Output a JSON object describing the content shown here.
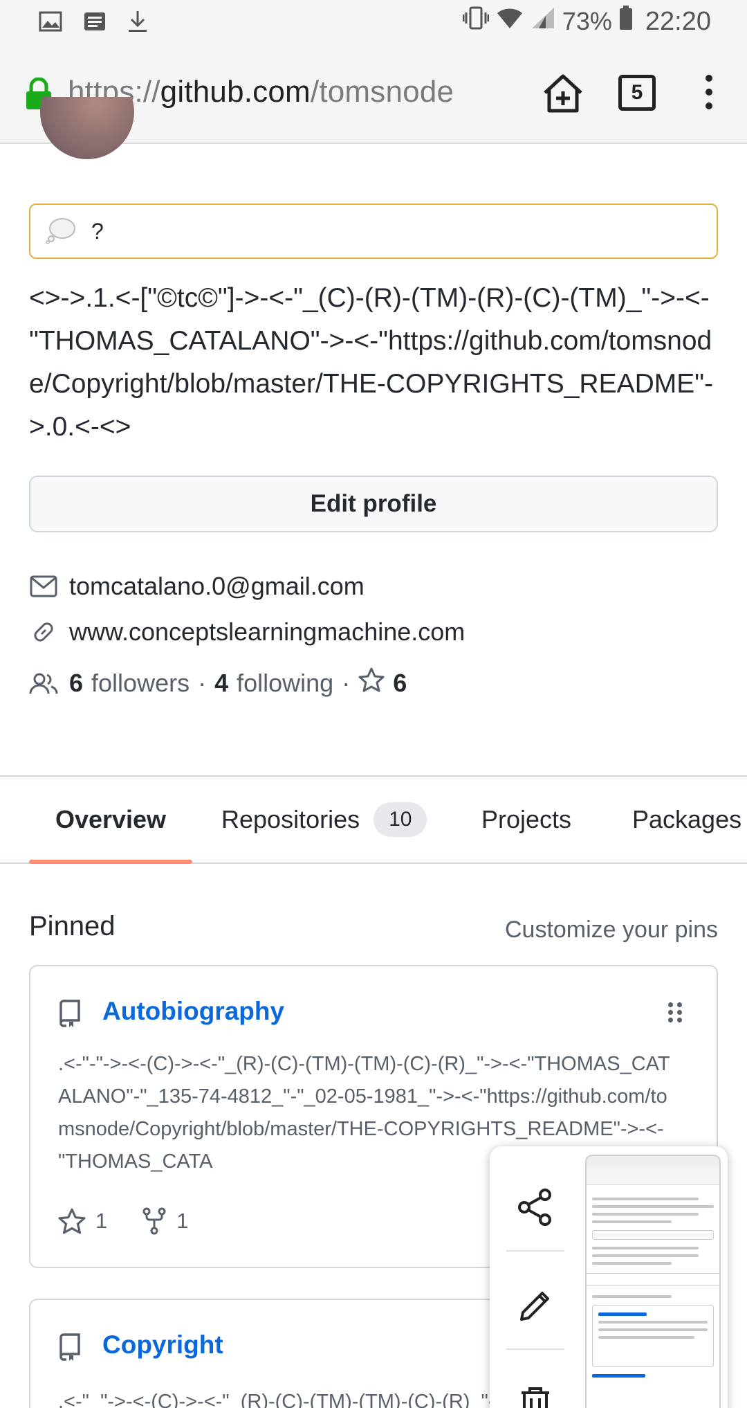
{
  "status_bar": {
    "battery_percent": "73%",
    "time": "22:20",
    "left_icons": [
      "image-icon",
      "news-icon",
      "download-icon"
    ],
    "right_icons": [
      "vibrate-icon",
      "wifi-icon",
      "signal-icon",
      "battery-icon"
    ]
  },
  "browser": {
    "url_scheme": "https://",
    "url_host": "github.com",
    "url_path": "/tomsnode",
    "tab_count": "5"
  },
  "profile": {
    "status_text": "?",
    "bio": "<>->.1.<-[\"©tc©\"]->-<-\"_(C)-(R)-(TM)-(R)-(C)-(TM)_\"->-<-\"THOMAS_CATALANO\"->-<-\"https://github.com/tomsnode/Copyright/blob/master/THE-COPYRIGHTS_README\"->.0.<-<>",
    "edit_profile_label": "Edit profile",
    "email": "tomcatalano.0@gmail.com",
    "website": "www.conceptslearningmachine.com",
    "followers_count": "6",
    "followers_label": "followers",
    "separator": "·",
    "following_count": "4",
    "following_label": "following",
    "stars_count": "6"
  },
  "tabs": [
    {
      "label": "Overview",
      "active": true
    },
    {
      "label": "Repositories",
      "counter": "10"
    },
    {
      "label": "Projects"
    },
    {
      "label": "Packages"
    }
  ],
  "pinned": {
    "title": "Pinned",
    "customize_label": "Customize your pins",
    "repos": [
      {
        "name": "Autobiography",
        "description": ".<-\"-\"->-<-(C)->-<-\"_(R)-(C)-(TM)-(TM)-(C)-(R)_\"->-<-\"THOMAS_CATALANO\"-\"_135-74-4812_\"-\"_02-05-1981_\"->-<-\"https://github.com/tomsnode/Copyright/blob/master/THE-COPYRIGHTS_README\"->-<-\"THOMAS_CATA",
        "stars": "1",
        "forks": "1"
      },
      {
        "name": "Copyright",
        "description": ".<-\"_\"->-<-(C)->-<-\"_(R)-(C)-(TM)-(TM)-(C)-(R)_\"-"
      }
    ]
  },
  "colors": {
    "link_blue": "#0969da",
    "tab_underline": "#fd8c73",
    "lock_green": "#1aaa1a",
    "status_border": "#e3b341"
  }
}
